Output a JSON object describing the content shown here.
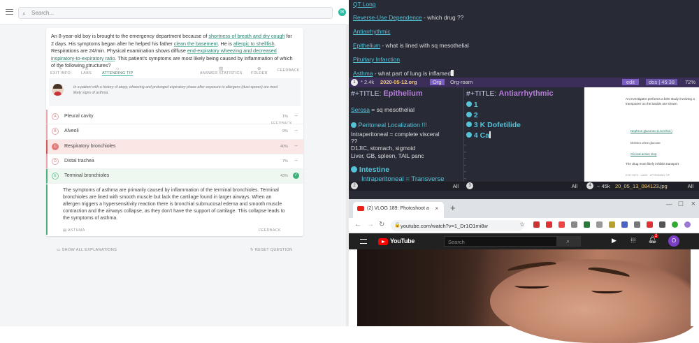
{
  "left": {
    "search_placeholder": "Search...",
    "question": {
      "stem_parts": [
        "An 8-year-old boy is brought to the emergency department because of ",
        "shortness of breath and dry cough",
        " for 2 days. His symptoms began after he helped his father ",
        "clean the basement",
        ". He is ",
        "allergic to shellfish",
        ". Respirations are 24/min. Physical examination shows diffuse ",
        "end-expiratory wheezing and decreased inspiratory-to-expiratory ratio",
        ". This patient's symptoms are most likely being caused by inflammation of which of the following structures?"
      ]
    },
    "tools": [
      "EXIT INFO",
      "LABS",
      "ATTENDING TIP",
      "ANSWER STATISTICS",
      "FOLDER",
      "FEEDBACK"
    ],
    "hint_text": "In a patient with a history of atopy, wheezing and prolonged expiratory phase after exposure to allergens (dust spores) are most likely signs of asthma.",
    "hint_feedback": "FEEDBACK",
    "options": [
      {
        "letter": "A",
        "label": "Pleural cavity",
        "pct": "1%"
      },
      {
        "letter": "B",
        "label": "Alveoli",
        "pct": "9%"
      },
      {
        "letter": "C",
        "label": "Respiratory bronchioles",
        "pct": "40%"
      },
      {
        "letter": "D",
        "label": "Distal trachea",
        "pct": "7%"
      },
      {
        "letter": "E",
        "label": "Terminal bronchioles",
        "pct": "43%"
      }
    ],
    "explanation": "The symptoms of asthma are primarily caused by inflammation of the terminal bronchioles. Terminal bronchioles are lined with smooth muscle but lack the cartilage found in larger airways. When an allergen triggers a hypersensitivity reaction there is bronchial submucosal edema and smooth muscle contraction and the airways collapse, as they don't have the support of cartilage. This collapse leads to the symptoms of asthma.",
    "explanation_footer": "ASTHMA",
    "explanation_feedback": "FEEDBACK",
    "show_all": "SHOW ALL EXPLANATIONS",
    "reset": "RESET QUESTION"
  },
  "org_top": [
    {
      "link": "QT Long",
      "rest": ""
    },
    {
      "link": "Reverse-Use Dependence",
      "rest": " - which drug ??"
    },
    {
      "link": "Antiarrhythmic",
      "rest": ""
    },
    {
      "link": "Epithelium",
      "rest": " - what is lined with sq mesothelial"
    },
    {
      "link": "Pituitary Infarction",
      "rest": ""
    },
    {
      "link": "Asthma",
      "rest": " - what part of lung is inflamed"
    }
  ],
  "modeline": {
    "num": "1",
    "size": "* 2.4k",
    "file": "2020-05-12.org",
    "mode": "Org",
    "mode2": "Org-roam",
    "status": "edit",
    "enc": "dos | 45:38",
    "pct": "72%"
  },
  "paneA": {
    "title_prefix": "#+TITLE: ",
    "title": "Epithelium",
    "line1_link": "Serosa",
    "line1_rest": " = sq mesothelial",
    "heading1": "Peritoneal Localization !!!",
    "l2": "Intraperitoneal = complete visceral",
    "l3": "??",
    "l4": "D1JIC, stomach, sigmoid",
    "l5": "Liver, GB, spleen, TAIL panc",
    "heading2": "Intestine",
    "l6": "Intraperitoneal = Transverse"
  },
  "paneB": {
    "title_prefix": "#+TITLE: ",
    "title": "Antiarrhythmic",
    "items": [
      "1",
      "2",
      "3 K Dofetilide",
      "4 Ca"
    ]
  },
  "paneC": {
    "t1": "An investigator performs a bele study involving a transporter on the baside are shown.",
    "opt1": "Nephron gluconeo (Liver/Kid.)",
    "opt2": "Distinct urine glucose",
    "opt3": "Clinical action step",
    "t2": "The drug most likely inhibits transport",
    "tools": [
      "EXIT INFO",
      "LABS",
      "ATTENDING TIP"
    ]
  },
  "winbars": [
    {
      "num": "2",
      "right": "All"
    },
    {
      "num": "3",
      "right": "All"
    },
    {
      "num": "4",
      "mid": "~ 45k",
      "file": "20_05_13_084123.jpg",
      "right": "All"
    }
  ],
  "chrome": {
    "tab_title": "(2) VLOG 189: Photoshoot a",
    "url": "youtube.com/watch?v=1_Dr1O1mi8w",
    "yt_name": "YouTube",
    "yt_search": "Search",
    "badge": "2",
    "avatar": "O"
  }
}
